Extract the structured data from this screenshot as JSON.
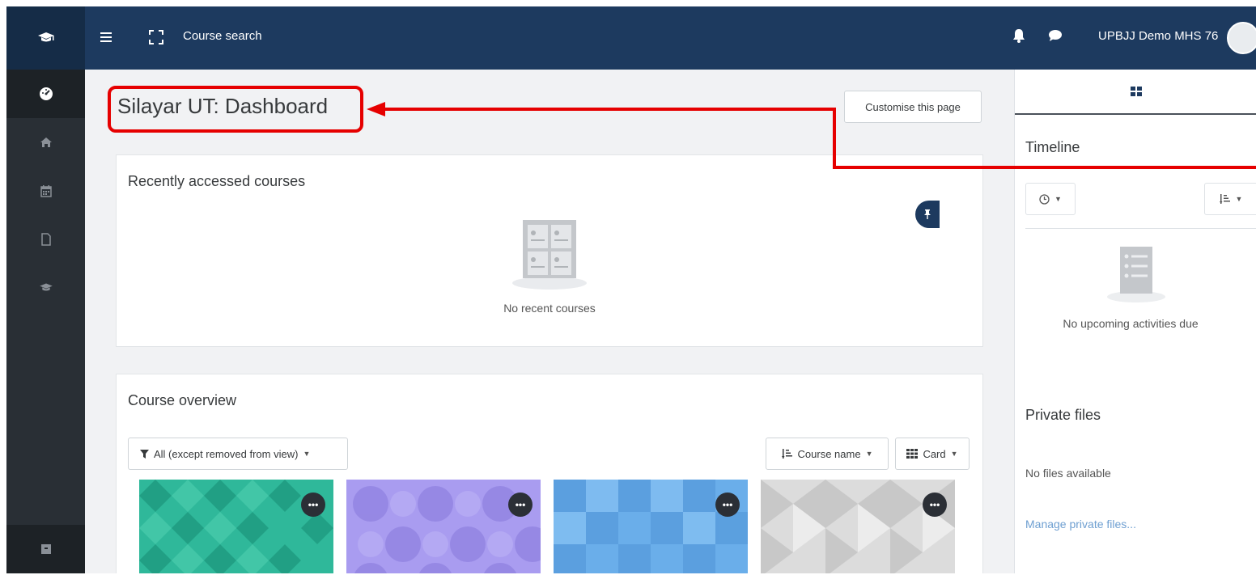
{
  "topbar": {
    "brand_icon": "graduation-cap-icon",
    "menu_icon": "hamburger-icon",
    "fullscreen_icon": "expand-icon",
    "course_search_label": "Course search",
    "notification_icon": "bell-icon",
    "messages_icon": "chat-bubble-icon",
    "username": "UPBJJ Demo MHS 76",
    "background_color": "#1d3a5f"
  },
  "sidebar": {
    "items": [
      {
        "icon": "dashboard-icon",
        "active": true
      },
      {
        "icon": "home-icon"
      },
      {
        "icon": "calendar-icon"
      },
      {
        "icon": "file-icon"
      },
      {
        "icon": "graduation-cap-icon"
      }
    ],
    "bottom_icon": "archive-icon",
    "background_color": "#292f35"
  },
  "main": {
    "page_title": "Silayar UT: Dashboard",
    "customise_label": "Customise this page",
    "recent": {
      "title": "Recently accessed courses",
      "empty_text": "No recent courses"
    },
    "overview": {
      "title": "Course overview",
      "filter_label": "All (except removed from view)",
      "sort_label": "Course name",
      "view_label": "Card",
      "tiles": [
        {
          "color": "#2fb89a",
          "menu": "•••"
        },
        {
          "color": "#a99cf0",
          "menu": "•••"
        },
        {
          "color": "#6aaeea",
          "menu": "•••"
        },
        {
          "color": "#d6d6d6",
          "menu": "•••"
        }
      ]
    }
  },
  "drawer": {
    "tab_icon": "blocks-grid-icon",
    "timeline_title": "Timeline",
    "timeline_empty": "No upcoming activities due",
    "private_files_title": "Private files",
    "private_files_empty": "No files available",
    "manage_link": "Manage private files..."
  },
  "annotation": {
    "color": "#e60000"
  }
}
